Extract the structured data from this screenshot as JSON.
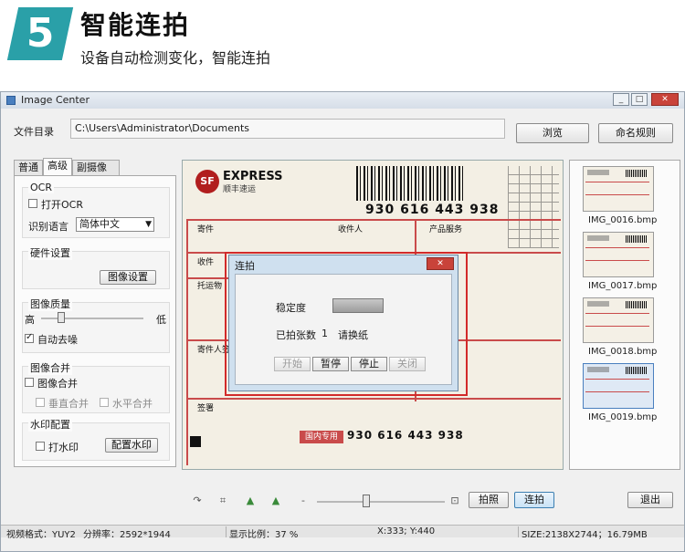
{
  "banner": {
    "number": "5",
    "title": "智能连拍",
    "subtitle": "设备自动检测变化，智能连拍",
    "accent_color": "#2aa0a8"
  },
  "window": {
    "title": "Image Center",
    "controls": [
      "minimize-icon",
      "maximize-icon",
      "close-icon"
    ]
  },
  "toolbar": {
    "dir_label": "文件目录",
    "dir_value": "C:\\Users\\Administrator\\Documents",
    "browse_label": "浏览",
    "naming_label": "命名规则"
  },
  "tabs": [
    {
      "label": "普通",
      "active": false
    },
    {
      "label": "高级",
      "active": true
    },
    {
      "label": "副摄像头",
      "active": false
    }
  ],
  "settings": {
    "ocr": {
      "title": "OCR",
      "enable_label": "打开OCR",
      "enabled": false,
      "lang_label": "识别语言",
      "lang_value": "简体中文"
    },
    "hardware": {
      "title": "硬件设置",
      "button_label": "图像设置"
    },
    "quality": {
      "title": "图像质量",
      "high": "高",
      "low": "低",
      "level": 0.2,
      "denoise_label": "自动去噪",
      "denoise": true
    },
    "merge": {
      "title": "图像合并",
      "enable_label": "图像合并",
      "enabled": false,
      "vertical_label": "垂直合并",
      "horizontal_label": "水平合并"
    },
    "watermark": {
      "title": "水印配置",
      "enable_label": "打水印",
      "enabled": false,
      "button_label": "配置水印"
    }
  },
  "document": {
    "logo_text": "SF",
    "brand": "EXPRESS",
    "brand_cn": "顺丰速运",
    "tracking": "930 616 443 938",
    "sections": [
      "寄件",
      "收件",
      "托运物",
      "寄件人签署",
      "签署",
      "产品服务",
      "收件人"
    ],
    "stamp": "国内专用"
  },
  "dialog": {
    "title": "连拍",
    "stability_label": "稳定度",
    "shot_count_label": "已拍张数",
    "shot_count": "1",
    "status": "请换纸",
    "buttons": [
      {
        "label": "开始",
        "enabled": false
      },
      {
        "label": "暂停",
        "enabled": true
      },
      {
        "label": "停止",
        "enabled": true
      },
      {
        "label": "关闭",
        "enabled": false
      }
    ]
  },
  "thumbnails": [
    {
      "name": "IMG_0016.bmp",
      "selected": false
    },
    {
      "name": "IMG_0017.bmp",
      "selected": false
    },
    {
      "name": "IMG_0018.bmp",
      "selected": false
    },
    {
      "name": "IMG_0019.bmp",
      "selected": true
    }
  ],
  "bottom": {
    "shot_label": "拍照",
    "continuous_label": "连拍",
    "exit_label": "退出",
    "icons": [
      "rotate-icon",
      "crop-icon",
      "flip-left-icon",
      "flip-right-icon",
      "zoom-out-icon",
      "zoom-fit-icon"
    ]
  },
  "statusbar": {
    "video_format": "视频格式：YUY2",
    "resolution": "分辨率：2592*1944",
    "scale": "显示比例：37 %",
    "coords": "X:333; Y:440",
    "size": "SIZE:2138X2744；16.79MB"
  }
}
